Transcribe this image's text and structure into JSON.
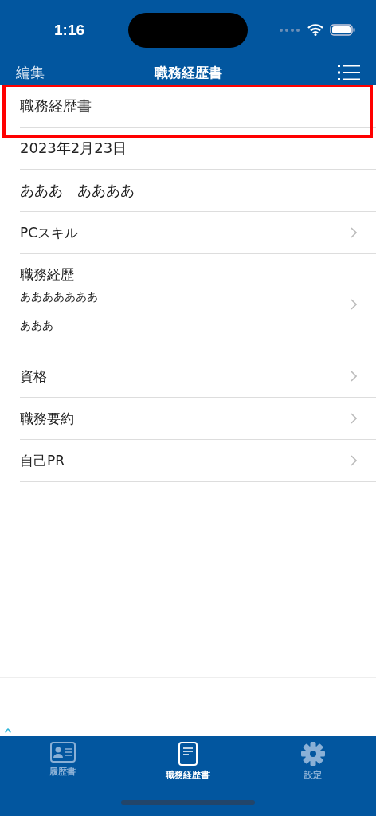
{
  "status_bar": {
    "time": "1:16"
  },
  "nav_bar": {
    "left": "編集",
    "title": "職務経歴書"
  },
  "rows": [
    {
      "kind": "text",
      "title": "職務経歴書",
      "highlighted": true
    },
    {
      "kind": "text",
      "title": "2023年2月23日",
      "highlighted": false
    },
    {
      "kind": "text",
      "title": "あああ　ああああ",
      "highlighted": false
    },
    {
      "kind": "link",
      "title": "PCスキル",
      "highlighted": false
    },
    {
      "kind": "link",
      "title": "職務経歴",
      "lines": [
        "あああああああ",
        "あああ"
      ],
      "highlighted": false
    },
    {
      "kind": "link",
      "title": "資格",
      "highlighted": false
    },
    {
      "kind": "link",
      "title": "職務要約",
      "highlighted": false
    },
    {
      "kind": "link",
      "title": "自己PR",
      "highlighted": false
    }
  ],
  "tab_bar": [
    {
      "label": "履歴書",
      "kind": "card",
      "selected": false
    },
    {
      "label": "職務経歴書",
      "kind": "doc",
      "selected": true
    },
    {
      "label": "設定",
      "kind": "gear",
      "selected": false
    }
  ]
}
